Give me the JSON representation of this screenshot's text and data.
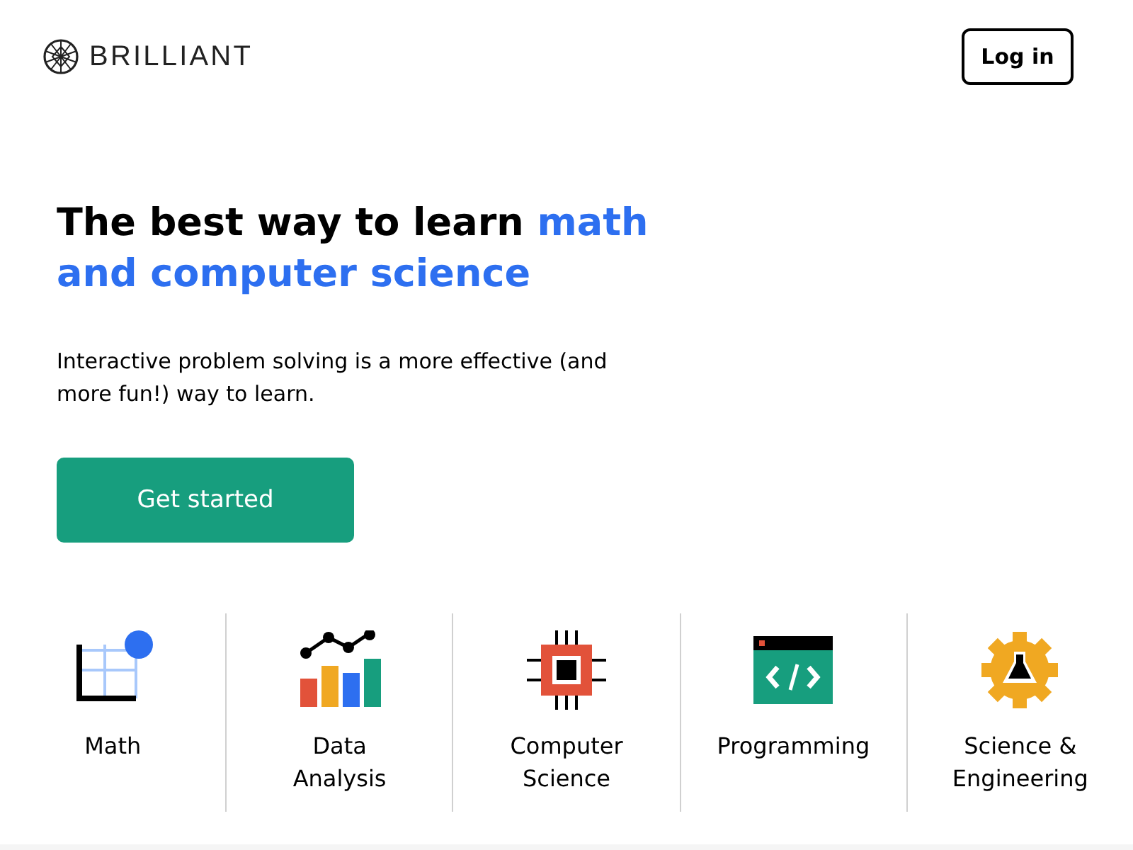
{
  "header": {
    "logo": "BRILLIANT",
    "login_button": "Log in"
  },
  "hero": {
    "headline": "The best way to learn",
    "headline_highlight": "math and computer science",
    "subtitle": "Interactive problem solving is a more effective (and more fun!) way to learn.",
    "cta_button": "Get started"
  },
  "topics": [
    {
      "kind": "math",
      "lines": [
        "Math"
      ]
    },
    {
      "kind": "data",
      "lines": [
        "Data",
        "Analysis"
      ]
    },
    {
      "kind": "cs",
      "lines": [
        "Computer",
        "Science"
      ]
    },
    {
      "kind": "programming",
      "lines": [
        "Programming"
      ]
    },
    {
      "kind": "science",
      "lines": [
        "Science &",
        "Engineering"
      ]
    }
  ]
}
